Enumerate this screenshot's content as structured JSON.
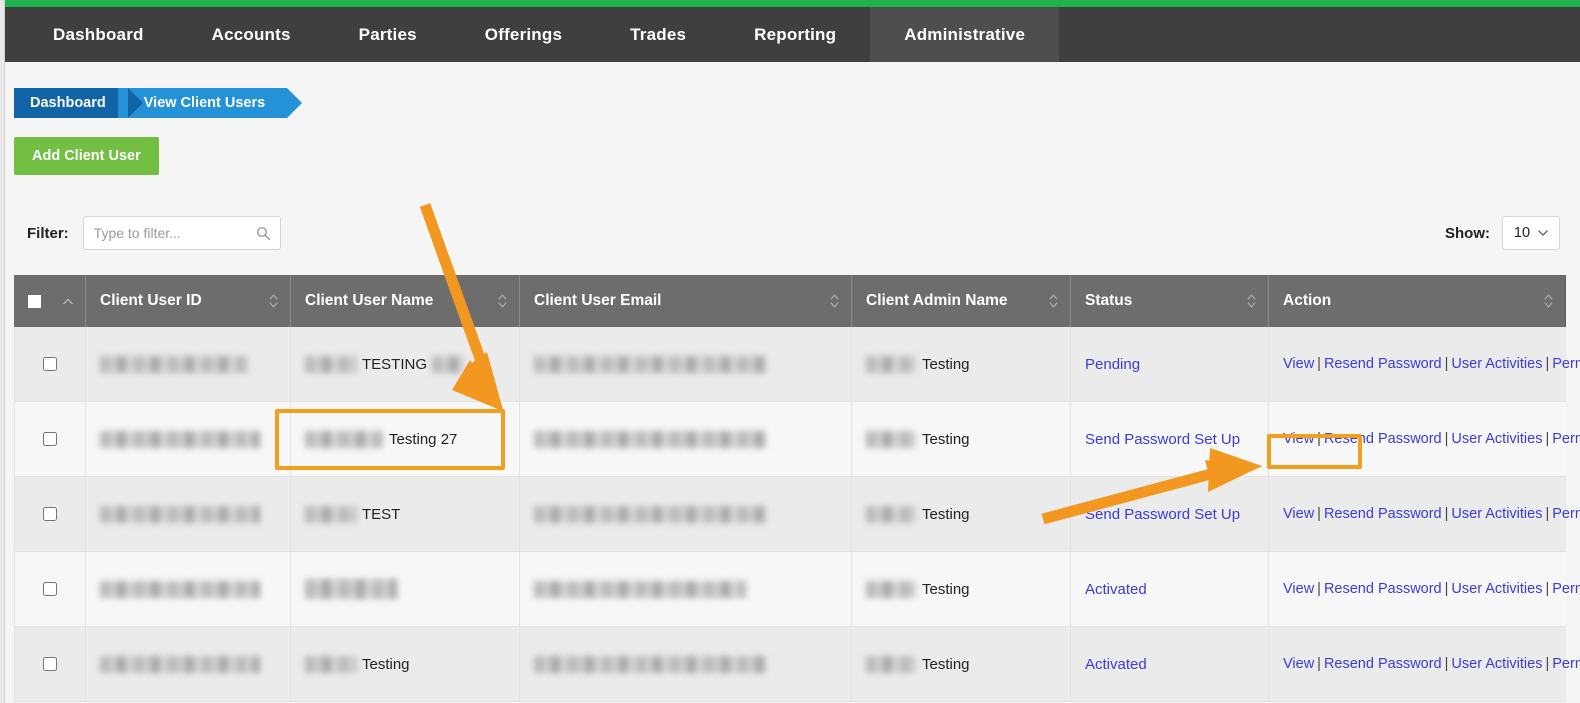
{
  "brand": {
    "accent_green": "#22b14c",
    "nav_bg": "#3f3f3f",
    "highlight_orange": "#f0a01e",
    "link_blue": "#3b3bd6"
  },
  "nav": {
    "items": [
      {
        "label": "Dashboard",
        "active": false
      },
      {
        "label": "Accounts",
        "active": false
      },
      {
        "label": "Parties",
        "active": false
      },
      {
        "label": "Offerings",
        "active": false
      },
      {
        "label": "Trades",
        "active": false
      },
      {
        "label": "Reporting",
        "active": false
      },
      {
        "label": "Administrative",
        "active": true
      }
    ]
  },
  "breadcrumb": {
    "items": [
      {
        "label": "Dashboard"
      },
      {
        "label": "View Client Users"
      }
    ]
  },
  "toolbar": {
    "add_label": "Add Client User"
  },
  "filter": {
    "label": "Filter:",
    "value": "",
    "placeholder": "Type to filter...",
    "icon": "search-icon"
  },
  "show": {
    "label": "Show:",
    "value": "10",
    "icon": "chevron-down-icon"
  },
  "table": {
    "select_all_icon": "checkbox-icon",
    "sort_icon": "sort-updown-icon",
    "columns": [
      {
        "key": "select",
        "label": "",
        "sortable": true
      },
      {
        "key": "client_user_id",
        "label": "Client User ID",
        "sortable": true
      },
      {
        "key": "client_user_name",
        "label": "Client User Name",
        "sortable": true
      },
      {
        "key": "client_user_email",
        "label": "Client User Email",
        "sortable": true
      },
      {
        "key": "client_admin_name",
        "label": "Client Admin Name",
        "sortable": true
      },
      {
        "key": "status",
        "label": "Status",
        "sortable": true
      },
      {
        "key": "action",
        "label": "Action",
        "sortable": true
      }
    ],
    "rows": [
      {
        "client_user_id": "",
        "client_user_name": "TESTING",
        "client_user_email": "",
        "client_admin_name": "Testing",
        "status": "Pending",
        "actions": [
          "View",
          "Resend Password",
          "User Activities",
          "Permission"
        ]
      },
      {
        "client_user_id": "",
        "client_user_name": "Testing 27",
        "client_user_email": "",
        "client_admin_name": "Testing",
        "status": "Send Password Set Up",
        "actions": [
          "View",
          "Resend Password",
          "User Activities",
          "Permission"
        ]
      },
      {
        "client_user_id": "",
        "client_user_name": "TEST",
        "client_user_email": "",
        "client_admin_name": "Testing",
        "status": "Send Password Set Up",
        "actions": [
          "View",
          "Resend Password",
          "User Activities",
          "Permission"
        ]
      },
      {
        "client_user_id": "",
        "client_user_name": "",
        "client_user_email": "",
        "client_admin_name": "Testing",
        "status": "Activated",
        "actions": [
          "View",
          "Resend Password",
          "User Activities",
          "Permission"
        ]
      },
      {
        "client_user_id": "",
        "client_user_name": "Testing",
        "client_user_email": "",
        "client_admin_name": "Testing",
        "status": "Activated",
        "actions": [
          "View",
          "Resend Password",
          "User Activities",
          "Permission"
        ]
      }
    ],
    "separator": "|"
  },
  "annotations": {
    "arrow_to_name": "arrow-pointing-to-client-user-name",
    "arrow_to_permission": "arrow-pointing-to-permission-link",
    "box_name": "highlight-box-client-user-name",
    "box_permission": "highlight-box-permission-link"
  }
}
